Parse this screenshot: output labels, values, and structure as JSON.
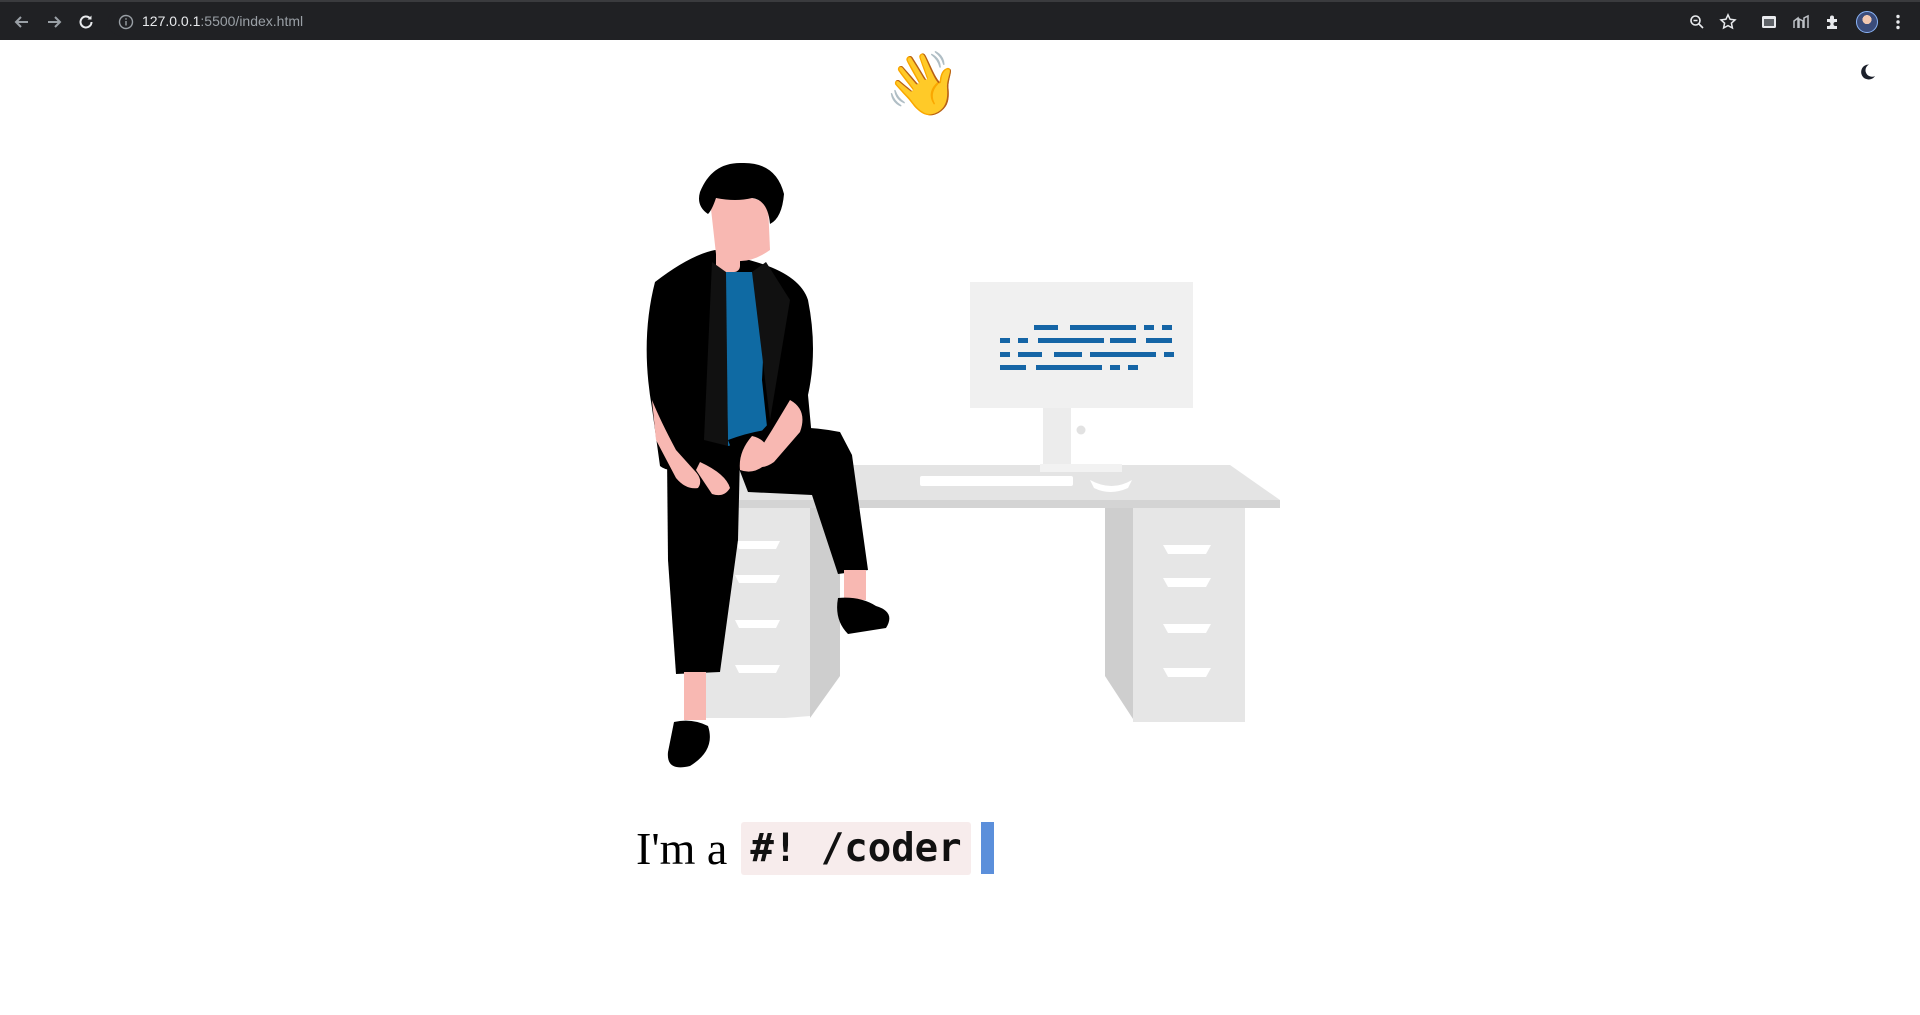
{
  "browser": {
    "url_host": "127.0.0.1",
    "url_rest": ":5500/index.html"
  },
  "page": {
    "wave_emoji": "👋",
    "theme_toggle_icon": "moon-icon",
    "tagline_prefix": "I'm a",
    "tagline_code": "#! /coder",
    "cursor_color": "#5b8fdb"
  },
  "colors": {
    "shirt": "#0f6aa3",
    "skin": "#f8b8b2",
    "screen_code": "#1565a6",
    "desk": "#e4e4e4"
  }
}
